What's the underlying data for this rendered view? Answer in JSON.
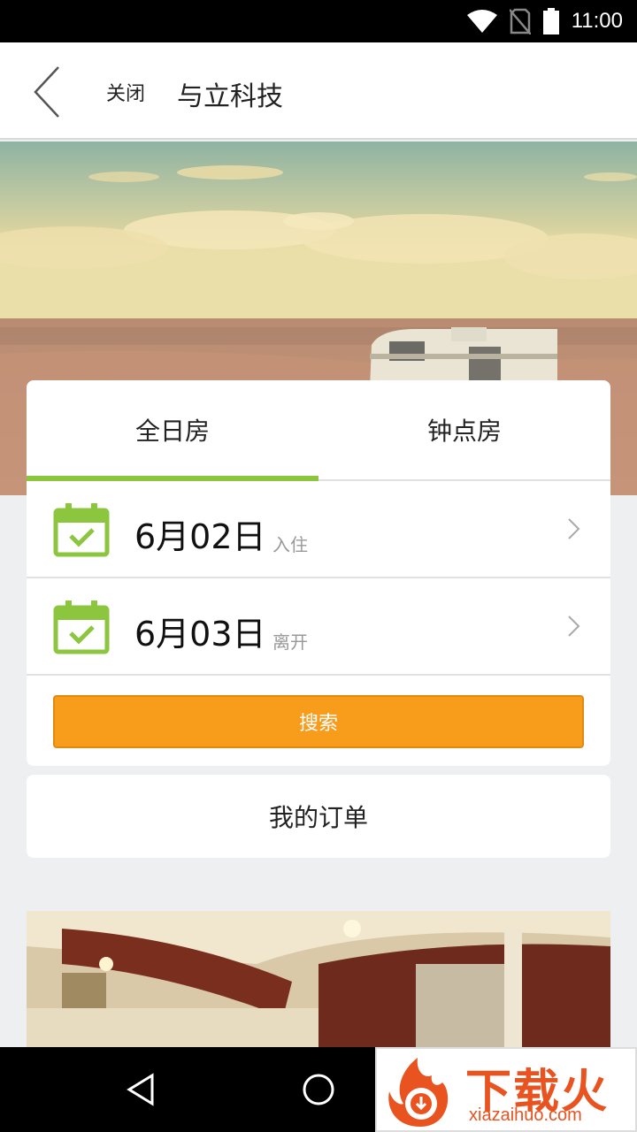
{
  "status_bar": {
    "time": "11:00"
  },
  "header": {
    "close_label": "关闭",
    "title": "与立科技"
  },
  "booking": {
    "tabs": [
      {
        "label": "全日房",
        "selected": true
      },
      {
        "label": "钟点房",
        "selected": false
      }
    ],
    "checkin": {
      "date": "6月02日",
      "label": "入住"
    },
    "checkout": {
      "date": "6月03日",
      "label": "离开"
    },
    "search_label": "搜索"
  },
  "orders_label": "我的订单",
  "watermark": {
    "name": "下载火",
    "url": "xiazaihuo.com"
  },
  "colors": {
    "accent_green": "#8cc63f",
    "search_orange": "#f89c1c",
    "watermark_orange": "#e8531f"
  }
}
